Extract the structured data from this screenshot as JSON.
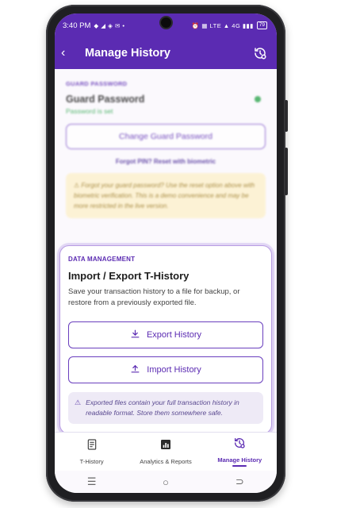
{
  "status_bar": {
    "time": "3:40 PM",
    "left_icons": "◆ ◢ ◈ ✉ •",
    "right_icons": "⏰ ▦ LTE ▲ 4G ▮▮▮",
    "battery": "79"
  },
  "app_bar": {
    "title": "Manage History",
    "back_glyph": "‹"
  },
  "guard": {
    "section_label": "GUARD PASSWORD",
    "title": "Guard Password",
    "status": "Password is set",
    "change_button": "Change Guard Password",
    "forgot_link": "Forgot PIN? Reset with biometric",
    "warning": "⚠ Forgot your guard password? Use the reset option above with biometric verification. This is a demo convenience and may be more restricted in the live version."
  },
  "data_management": {
    "section_label": "DATA MANAGEMENT",
    "title": "Import / Export T-History",
    "description": "Save your transaction history to a file for backup, or restore from a previously exported file.",
    "export_button": "Export History",
    "import_button": "Import History",
    "note_icon": "⚠",
    "note": "Exported files contain your full transaction history in readable format. Store them somewhere safe."
  },
  "bottom_nav": {
    "items": [
      {
        "label": "T-History",
        "icon": "receipt-icon"
      },
      {
        "label": "Analytics & Reports",
        "icon": "analytics-icon"
      },
      {
        "label": "Manage History",
        "icon": "history-settings-icon",
        "active": true
      }
    ]
  },
  "system_nav": {
    "recents": "☰",
    "home": "○",
    "back": "⊃"
  },
  "colors": {
    "primary": "#5b2bb2",
    "success": "#34a853",
    "warning_bg": "#fdf1cd",
    "note_bg": "#eeeaf6"
  }
}
